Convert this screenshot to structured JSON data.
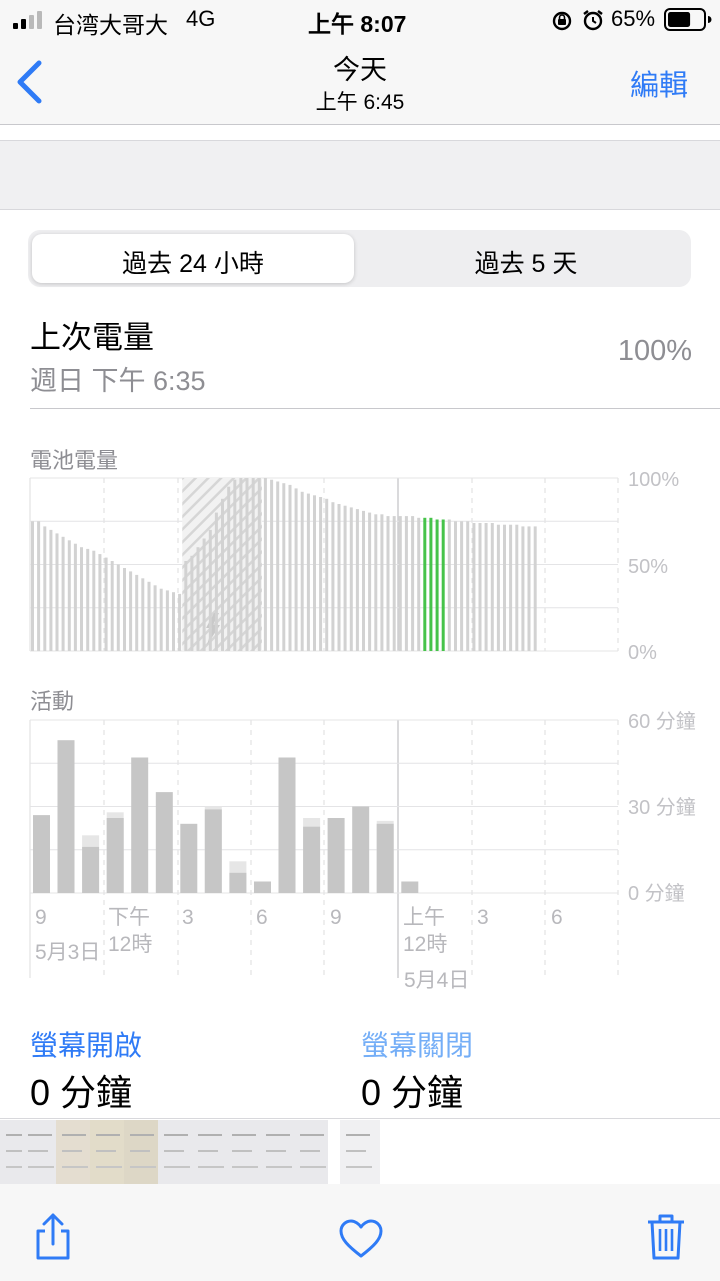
{
  "status_bar": {
    "carrier": "台湾大哥大",
    "network": "4G",
    "time": "上午 8:07",
    "battery": "65%",
    "battery_level": 0.65
  },
  "nav": {
    "back_icon": "chevron-left-icon",
    "title": "今天",
    "subtitle": "上午 6:45",
    "edit_label": "編輯"
  },
  "segmented": {
    "tabs": [
      {
        "label": "過去 24 小時",
        "selected": true
      },
      {
        "label": "過去 5 天",
        "selected": false
      }
    ]
  },
  "last_charge": {
    "label": "上次電量",
    "time": "週日 下午 6:35",
    "value": "100%"
  },
  "battery_chart": {
    "title": "電池電量",
    "y_ticks": [
      "100%",
      "50%",
      "0%"
    ]
  },
  "activity_chart": {
    "title": "活動",
    "y_ticks": [
      "60 分鐘",
      "30 分鐘",
      "0 分鐘"
    ]
  },
  "x_axis": {
    "ticks": [
      "9",
      "下午",
      "3",
      "6",
      "9",
      "上午",
      "3",
      "6"
    ],
    "ticks_line2": [
      "12時",
      "12時"
    ],
    "dates": [
      "5月3日",
      "5月4日"
    ]
  },
  "screen": {
    "on_label": "螢幕開啟",
    "on_value": "0 分鐘",
    "off_label": "螢幕關閉",
    "off_value": "0 分鐘"
  },
  "toolbar": {
    "share_icon": "share-icon",
    "favorite_icon": "heart-icon",
    "delete_icon": "trash-icon"
  },
  "colors": {
    "accent": "#2f7bf6",
    "light_accent": "#74aef7",
    "charging_green": "#46c34a",
    "bar_gray": "#cfcfcf"
  },
  "chart_data": [
    {
      "type": "bar",
      "title": "電池電量",
      "y_unit": "%",
      "ylim": [
        0,
        100
      ],
      "y_ticks": [
        0,
        50,
        100
      ],
      "x_ticks": [
        "9",
        "下午 12時",
        "3",
        "6",
        "9",
        "上午 12時",
        "3",
        "6"
      ],
      "x_dates": [
        "5月3日",
        "5月4日"
      ],
      "series": [
        {
          "values": [
            75,
            75,
            72,
            70,
            68,
            66,
            64,
            62,
            60,
            59,
            58,
            56,
            54,
            52,
            50,
            48,
            46,
            44,
            42,
            40,
            38,
            36,
            35,
            34,
            33,
            52,
            55,
            60,
            65,
            70,
            80,
            88,
            95,
            99,
            100,
            100,
            100,
            100,
            100,
            99,
            98,
            97,
            96,
            94,
            92,
            91,
            90,
            89,
            88,
            86,
            85,
            84,
            83,
            82,
            81,
            80,
            79,
            79,
            78,
            78,
            78,
            78,
            78,
            77,
            77,
            77,
            76,
            76,
            76,
            75,
            75,
            75,
            74,
            74,
            74,
            74,
            73,
            73,
            73,
            73,
            72,
            72,
            72
          ]
        }
      ],
      "charging_period": [
        25,
        38
      ],
      "highlight_bars": [
        64,
        65,
        66,
        67
      ]
    },
    {
      "type": "bar",
      "title": "活動",
      "y_unit": "分鐘",
      "ylim": [
        0,
        60
      ],
      "y_ticks": [
        0,
        30,
        60
      ],
      "x_ticks": [
        "9",
        "下午 12時",
        "3",
        "6",
        "9",
        "上午 12時",
        "3",
        "6"
      ],
      "x_dates": [
        "5月3日",
        "5月4日"
      ],
      "series": [
        {
          "name": "螢幕開啟",
          "values": [
            27,
            53,
            16,
            26,
            47,
            35,
            24,
            29,
            7,
            4,
            47,
            23,
            26,
            30,
            24,
            4,
            0,
            0,
            0,
            0,
            0,
            0,
            0,
            0
          ]
        },
        {
          "name": "螢幕關閉",
          "values": [
            0,
            0,
            4,
            2,
            0,
            0,
            0,
            1,
            4,
            0,
            0,
            3,
            0,
            0,
            1,
            0,
            0,
            0,
            0,
            0,
            0,
            0,
            0,
            0
          ]
        }
      ]
    }
  ]
}
